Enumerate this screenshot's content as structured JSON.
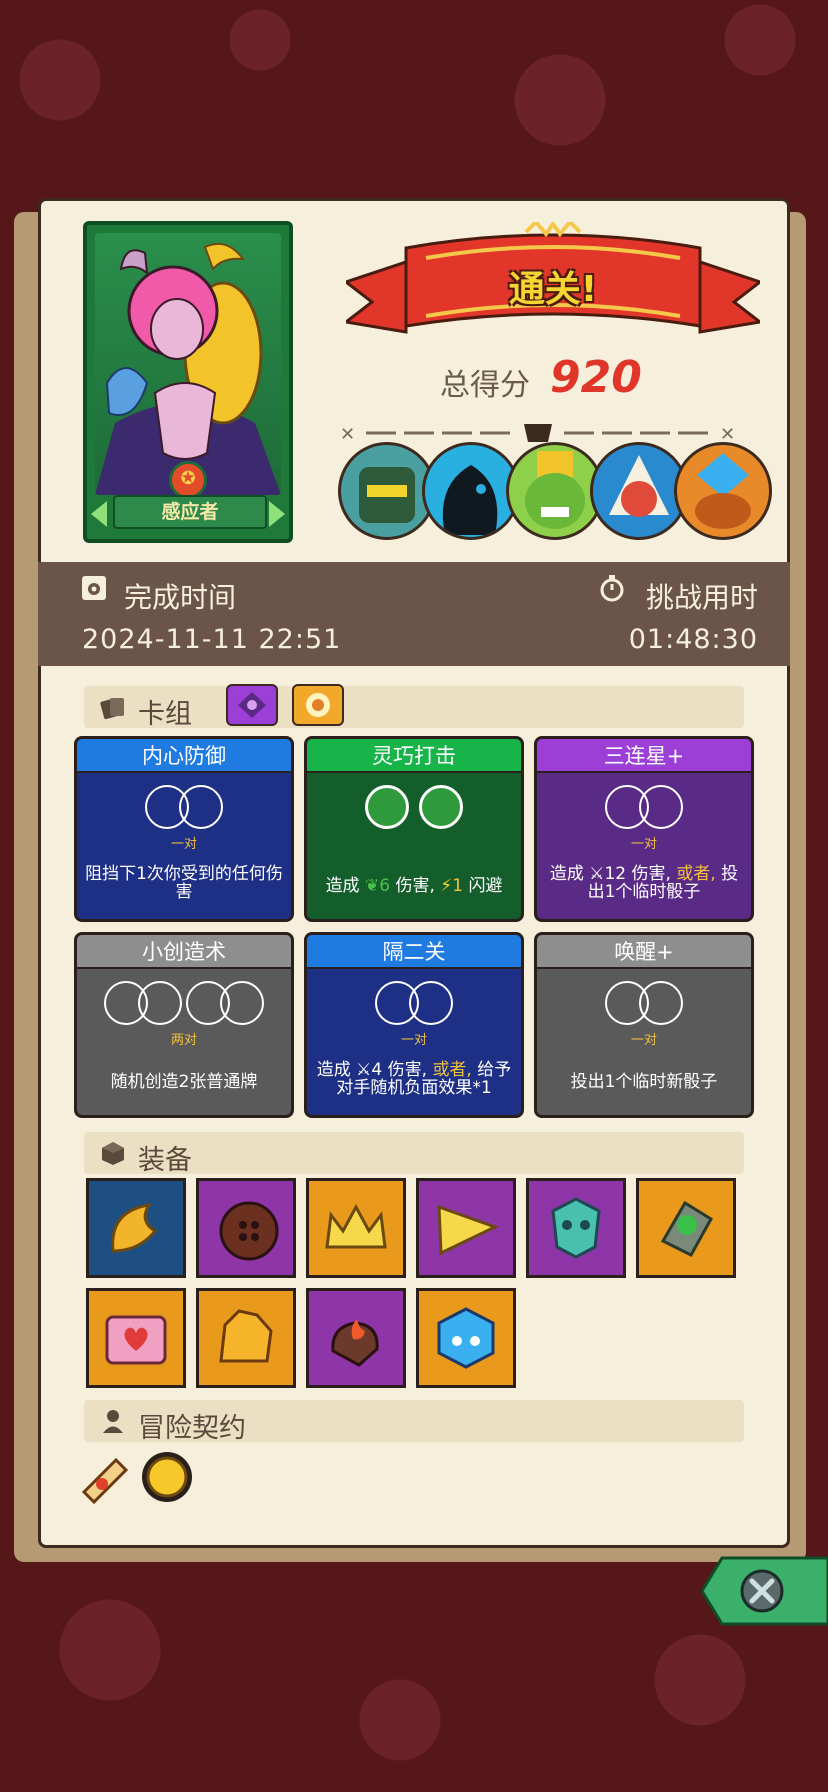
{
  "hero": {
    "name": "感应者"
  },
  "result": {
    "banner": "通关!",
    "score_label": "总得分",
    "score_value": "920"
  },
  "bosses": [
    "boss-1-icon",
    "boss-2-icon",
    "boss-3-icon",
    "boss-4-icon",
    "boss-5-icon"
  ],
  "time": {
    "finish_label": "完成时间",
    "finish_value": "2024-11-11  22:51",
    "duration_label": "挑战用时",
    "duration_value": "01:48:30"
  },
  "deck": {
    "title": "卡组",
    "cards": [
      {
        "title": "内心防御",
        "combo": "一对",
        "desc": "阻挡下1次你受到的任何伤害",
        "color": "blue"
      },
      {
        "title": "灵巧打击",
        "combo": "",
        "desc_pre": "造成",
        "desc_num1": "6",
        "desc_mid": "伤害,",
        "desc_num2": "1",
        "desc_post": "闪避",
        "color": "green"
      },
      {
        "title": "三连星+",
        "combo": "一对",
        "desc_pre": "造成",
        "desc_num": "12",
        "desc_mid": "伤害,",
        "desc_hl": "或者,",
        "desc_post": "投出1个临时骰子",
        "color": "purple"
      },
      {
        "title": "小创造术",
        "combo": "两对",
        "desc": "随机创造2张普通牌",
        "color": "grey"
      },
      {
        "title": "隔二关",
        "combo": "一对",
        "desc_pre": "造成",
        "desc_num": "4",
        "desc_mid": "伤害,",
        "desc_hl": "或者,",
        "desc_post": "给予对手随机负面效果*1",
        "color": "blue"
      },
      {
        "title": "唤醒+",
        "combo": "一对",
        "desc": "投出1个临时新骰子",
        "color": "grey"
      }
    ]
  },
  "equipment": {
    "title": "装备",
    "items": [
      {
        "icon": "horn-icon",
        "bg": "#1d4f82"
      },
      {
        "icon": "button-icon",
        "bg": "#8e35a8"
      },
      {
        "icon": "crown-icon",
        "bg": "#e99a1c"
      },
      {
        "icon": "cheese-icon",
        "bg": "#8e35a8"
      },
      {
        "icon": "demon-mask-icon",
        "bg": "#8e35a8"
      },
      {
        "icon": "moss-stone-icon",
        "bg": "#e99a1c"
      },
      {
        "icon": "heart-box-icon",
        "bg": "#e99a1c"
      },
      {
        "icon": "fire-crystal-icon",
        "bg": "#e99a1c"
      },
      {
        "icon": "flame-rock-icon",
        "bg": "#8e35a8"
      },
      {
        "icon": "ice-cube-icon",
        "bg": "#e99a1c"
      }
    ]
  },
  "contract": {
    "title": "冒险契约",
    "items": [
      "scroll-icon",
      "gold-coin-icon"
    ]
  },
  "colors": {
    "paper": "#f6efdc",
    "time_bar": "#6b5548",
    "score": "#e0362a"
  }
}
